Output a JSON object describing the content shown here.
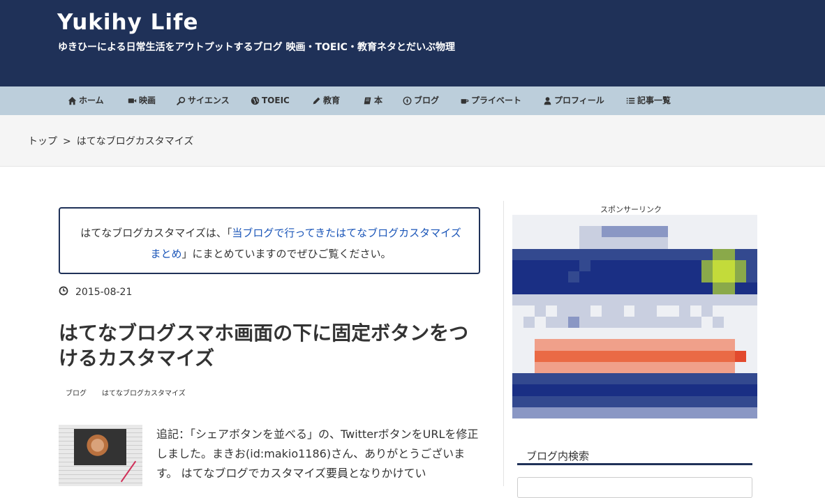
{
  "header": {
    "site_title": "Yukihy Life",
    "site_description": "ゆきひーによる日常生活をアウトプットするブログ 映画・TOEIC・教育ネタとだいぶ物理"
  },
  "nav": {
    "items": [
      {
        "label": "ホーム",
        "icon": "home-icon"
      },
      {
        "label": "映画",
        "icon": "video-camera-icon"
      },
      {
        "label": "サイエンス",
        "icon": "search-icon"
      },
      {
        "label": "TOEIC",
        "icon": "globe-icon"
      },
      {
        "label": "教育",
        "icon": "pencil-icon"
      },
      {
        "label": "本",
        "icon": "book-icon"
      },
      {
        "label": "ブログ",
        "icon": "compass-icon"
      },
      {
        "label": "プライベート",
        "icon": "coffee-icon"
      },
      {
        "label": "プロフィール",
        "icon": "user-icon"
      },
      {
        "label": "記事一覧",
        "icon": "list-icon"
      }
    ]
  },
  "breadcrumb": {
    "home": "トップ",
    "separator": ">",
    "current": "はてなブログカスタマイズ"
  },
  "notice": {
    "text_before": "はてなブログカスタマイズは、「",
    "link_text": "当ブログで行ってきたはてなブログカスタマイズまとめ",
    "text_after": "」にまとめていますのでぜひご覧ください。"
  },
  "article": {
    "date": "2015-08-21",
    "title": "はてなブログスマホ画面の下に固定ボタンをつけるカスタマイズ",
    "categories": [
      "ブログ",
      "はてなブログカスタマイズ"
    ],
    "body_text": "追記：「シェアボタンを並べる」の、TwitterボタンをURLを修正しました。まきお(id:makio1186)さん、ありがとうございます。 はてなブログでカスタマイズ要員となりかけてい"
  },
  "sidebar": {
    "sponsor_label": "スポンサーリンク",
    "search_widget_title": "ブログ内検索",
    "search_input_value": ""
  },
  "colors": {
    "header_bg": "#1f3158",
    "nav_bg": "#bccedb",
    "link": "#1a55b8",
    "notice_border": "#1f3158"
  }
}
